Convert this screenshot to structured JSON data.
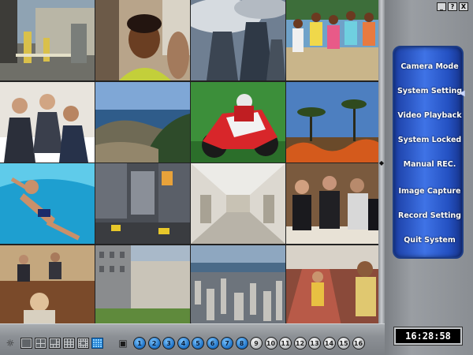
{
  "window": {
    "controls": [
      "_",
      "?",
      "X"
    ]
  },
  "cameras": [
    {
      "id": 1,
      "scene": "industrial-gate"
    },
    {
      "id": 2,
      "scene": "smiling-woman"
    },
    {
      "id": 3,
      "scene": "cooling-towers"
    },
    {
      "id": 4,
      "scene": "group-beach"
    },
    {
      "id": 5,
      "scene": "business-meeting"
    },
    {
      "id": 6,
      "scene": "coastline"
    },
    {
      "id": 7,
      "scene": "motorcycle-race"
    },
    {
      "id": 8,
      "scene": "savanna-fire"
    },
    {
      "id": 9,
      "scene": "swimmer"
    },
    {
      "id": 10,
      "scene": "city-street"
    },
    {
      "id": 11,
      "scene": "corridor"
    },
    {
      "id": 12,
      "scene": "dinner-party"
    },
    {
      "id": 13,
      "scene": "conference-room"
    },
    {
      "id": 14,
      "scene": "building-plaza"
    },
    {
      "id": 15,
      "scene": "aerial-city"
    },
    {
      "id": 16,
      "scene": "bus-interior"
    }
  ],
  "menu": {
    "items": [
      {
        "label": "Camera Mode"
      },
      {
        "label": "System Setting"
      },
      {
        "label": "Video Playback"
      },
      {
        "label": "System Locked"
      },
      {
        "label": "Manual REC."
      },
      {
        "label": "Image Capture"
      },
      {
        "label": "Record Setting"
      },
      {
        "label": "Quit System"
      }
    ],
    "active_index": 1
  },
  "clock": "16:28:58",
  "toolbar": {
    "layouts": [
      "single",
      "quad",
      "six",
      "nine",
      "thirteen",
      "sixteen"
    ],
    "selected_layout": "sixteen",
    "camera_buttons": [
      {
        "label": "1",
        "on": true
      },
      {
        "label": "2",
        "on": true
      },
      {
        "label": "3",
        "on": true
      },
      {
        "label": "4",
        "on": true
      },
      {
        "label": "5",
        "on": true
      },
      {
        "label": "6",
        "on": true
      },
      {
        "label": "7",
        "on": true
      },
      {
        "label": "8",
        "on": true
      },
      {
        "label": "9",
        "on": false
      },
      {
        "label": "10",
        "on": false
      },
      {
        "label": "11",
        "on": false
      },
      {
        "label": "12",
        "on": false
      },
      {
        "label": "13",
        "on": false
      },
      {
        "label": "14",
        "on": false
      },
      {
        "label": "15",
        "on": false
      },
      {
        "label": "16",
        "on": false
      }
    ]
  },
  "colors": {
    "accent": "#2d5fd6",
    "camera_on": "#1b6fc4",
    "camera_off": "#b4b7ba",
    "clock_bg": "#000000"
  }
}
